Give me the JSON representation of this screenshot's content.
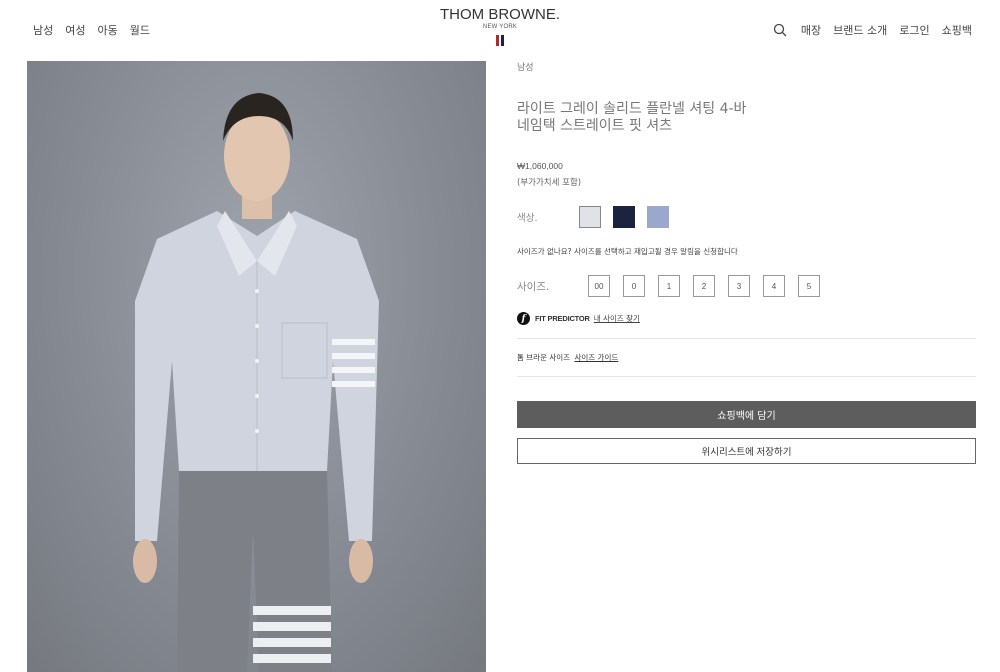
{
  "header": {
    "nav_left": [
      "남성",
      "여성",
      "아동",
      "월드"
    ],
    "logo": {
      "brand": "THOM BROWNE.",
      "city": "NEW YORK",
      "flag_colors": [
        "#b3262d",
        "#1b2344"
      ]
    },
    "nav_right": [
      "매장",
      "브랜드 소개",
      "로그인",
      "쇼핑백"
    ]
  },
  "product": {
    "category": "남성",
    "title": "라이트 그레이 솔리드 플란넬 셔팅 4-바 네임택 스트레이트 핏 셔츠",
    "price": "₩1,060,000",
    "vat_note": "(부가가치세 포함)",
    "color_label": "색상.",
    "colors": [
      "#dfe3e8",
      "#1c2340",
      "#9aa8cc"
    ],
    "restock_notice": "사이즈가 없나요? 사이즈를 선택하고 재입고될 경우 알림을 신청합니다",
    "size_label": "사이즈.",
    "sizes": [
      "00",
      "0",
      "1",
      "2",
      "3",
      "4",
      "5"
    ],
    "fit_predictor_label": "FIT PREDICTOR",
    "fit_predictor_link": "내 사이즈 찾기",
    "size_guide_prefix": "톰 브라운 사이즈",
    "size_guide_link": "사이즈 가이드",
    "add_to_bag": "쇼핑백에 담기",
    "add_to_wishlist": "위시리스트에 저장하기"
  }
}
